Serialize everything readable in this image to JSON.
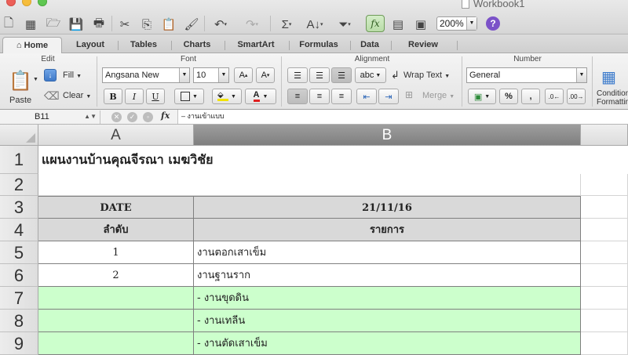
{
  "window": {
    "title": "Workbook1"
  },
  "toolbar": {
    "zoom": "200%",
    "fx": "fx",
    "help": "?"
  },
  "tabs": [
    "Home",
    "Layout",
    "Tables",
    "Charts",
    "SmartArt",
    "Formulas",
    "Data",
    "Review"
  ],
  "ribbon": {
    "groups": {
      "edit": "Edit",
      "font": "Font",
      "alignment": "Alignment",
      "number": "Number"
    },
    "paste": "Paste",
    "fill": "Fill",
    "clear": "Clear",
    "font_name": "Angsana New",
    "font_size": "10",
    "bold": "B",
    "italic": "I",
    "underline": "U",
    "abc": "abc",
    "wrap_text": "Wrap Text",
    "merge": "Merge",
    "number_format": "General",
    "percent": "%",
    "comma": ",",
    "conditional": "Conditional",
    "conditional2": "Formatting"
  },
  "formula_bar": {
    "cell_ref": "B11",
    "fx": "fx",
    "content": "– งานเข้าแบบ"
  },
  "columns": [
    "A",
    "B"
  ],
  "rows": [
    "1",
    "2",
    "3",
    "4",
    "5",
    "6",
    "7",
    "8",
    "9"
  ],
  "sheet": {
    "title": "แผนงานบ้านคุณจีรณา เมฆวิชัย",
    "date_label": "DATE",
    "date_value": "21/11/16",
    "col_a_header": "ลำดับ",
    "col_b_header": "รายการ",
    "items": [
      {
        "no": "1",
        "text": "งานตอกเสาเข็ม"
      },
      {
        "no": "2",
        "text": "งานฐานราก"
      },
      {
        "no": "",
        "text": "- งานขุดดิน"
      },
      {
        "no": "",
        "text": "- งานเทลีน"
      },
      {
        "no": "",
        "text": "- งานตัดเสาเข็ม"
      }
    ]
  }
}
